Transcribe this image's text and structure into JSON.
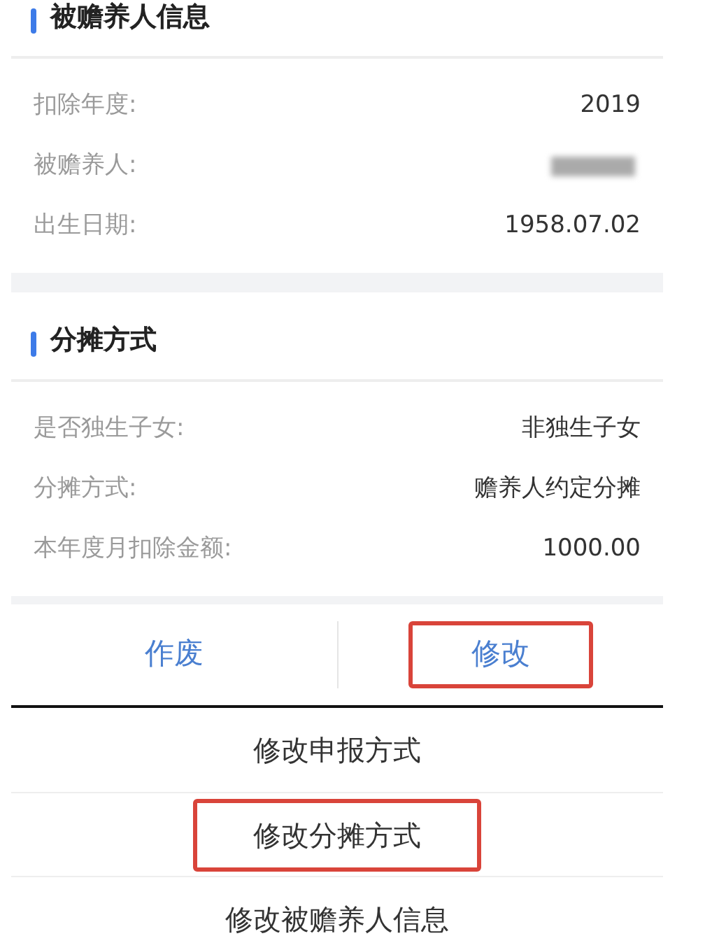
{
  "sections": [
    {
      "title": "被赡养人信息",
      "rows": [
        {
          "kind": "text",
          "label": "扣除年度:",
          "value": "2019"
        },
        {
          "kind": "redacted",
          "label": "被赡养人:"
        },
        {
          "kind": "text",
          "label": "出生日期:",
          "value": "1958.07.02"
        }
      ]
    },
    {
      "title": "分摊方式",
      "rows": [
        {
          "kind": "text",
          "label": "是否独生子女:",
          "value": "非独生子女"
        },
        {
          "kind": "text",
          "label": "分摊方式:",
          "value": "赡养人约定分摊"
        },
        {
          "kind": "text",
          "label": "本年度月扣除金额:",
          "value": "1000.00"
        }
      ]
    }
  ],
  "actions": [
    {
      "label": "作废",
      "highlighted": false
    },
    {
      "label": "修改",
      "highlighted": true
    }
  ],
  "menu": [
    {
      "label": "修改申报方式",
      "highlighted": false
    },
    {
      "label": "修改分摊方式",
      "highlighted": true
    },
    {
      "label": "修改被赡养人信息",
      "highlighted": false
    }
  ]
}
